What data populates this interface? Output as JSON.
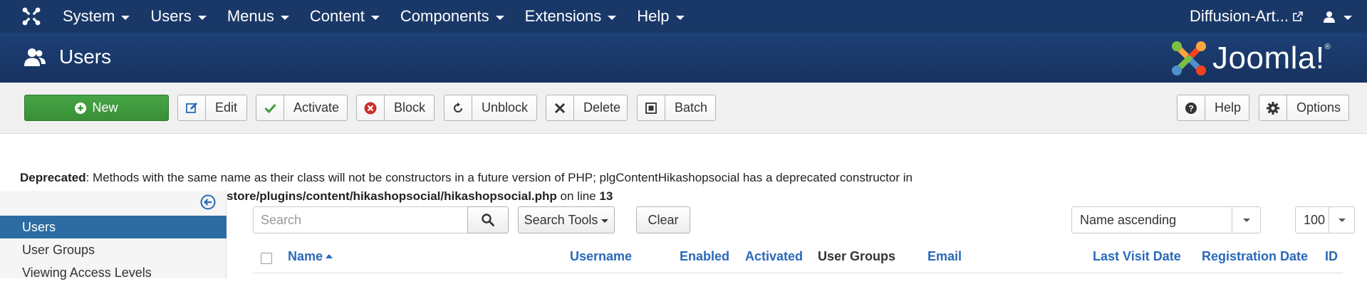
{
  "colors": {
    "navbar": "#1a3867",
    "header": "#1c3d72",
    "new_button": "#46a546",
    "sidebar_active": "#2d6ca2",
    "link": "#2a69b8"
  },
  "navbar": {
    "menu": [
      {
        "label": "System"
      },
      {
        "label": "Users"
      },
      {
        "label": "Menus"
      },
      {
        "label": "Content"
      },
      {
        "label": "Components"
      },
      {
        "label": "Extensions"
      },
      {
        "label": "Help"
      }
    ],
    "site_name": "Diffusion-Art...",
    "site_icon": "external-link-icon",
    "user_icon": "user-icon"
  },
  "header": {
    "title": "Users",
    "title_icon": "users-icon",
    "logo_text": "Joomla!",
    "logo_reg": "®"
  },
  "toolbar": {
    "new": "New",
    "edit": "Edit",
    "activate": "Activate",
    "block": "Block",
    "unblock": "Unblock",
    "delete": "Delete",
    "batch": "Batch",
    "help": "Help",
    "options": "Options"
  },
  "message": {
    "label": "Deprecated",
    "text": ": Methods with the same name as their class will not be constructors in a future version of PHP; plgContentHikashopsocial has a deprecated constructor in",
    "path": "store/plugins/content/hikashopsocial/hikashopsocial.php",
    "on_line": " on line ",
    "line": "13"
  },
  "sidebar": {
    "items": [
      {
        "label": "Users",
        "active": true
      },
      {
        "label": "User Groups"
      },
      {
        "label": "Viewing Access Levels"
      }
    ]
  },
  "filters": {
    "search_placeholder": "Search",
    "search_tools": "Search Tools",
    "clear": "Clear",
    "ordering": "Name ascending",
    "limit": "100"
  },
  "table": {
    "columns": {
      "name": "Name",
      "username": "Username",
      "enabled": "Enabled",
      "activated": "Activated",
      "user_groups": "User Groups",
      "email": "Email",
      "last_visit": "Last Visit Date",
      "registration": "Registration Date",
      "id": "ID"
    }
  }
}
